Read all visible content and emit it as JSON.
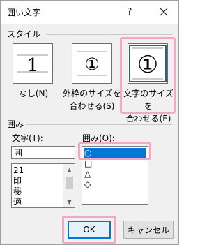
{
  "window": {
    "title": "囲い文字",
    "help_label": "?"
  },
  "style_section": {
    "label": "スタイル",
    "options": [
      {
        "glyph": "1",
        "label": "なし(N)"
      },
      {
        "glyph": "①",
        "label_line1": "外枠のサイズを",
        "label_line2": "合わせる(S)"
      },
      {
        "glyph": "①",
        "label_line1": "文字のサイズを",
        "label_line2": "合わせる(E)",
        "selected": true
      }
    ]
  },
  "enclose_section": {
    "label": "囲み",
    "char_label": "文字(T):",
    "char_value": "囲",
    "char_list": [
      "21",
      "印",
      "秘",
      "適"
    ],
    "enclosure_label": "囲み(O):",
    "enclosures": [
      "○",
      "□",
      "△",
      "◇"
    ],
    "selected_enclosure_index": 0
  },
  "buttons": {
    "ok": "OK",
    "cancel": "キャンセル"
  },
  "colors": {
    "highlight": "#f4a6c5",
    "selection": "#0078d7"
  }
}
